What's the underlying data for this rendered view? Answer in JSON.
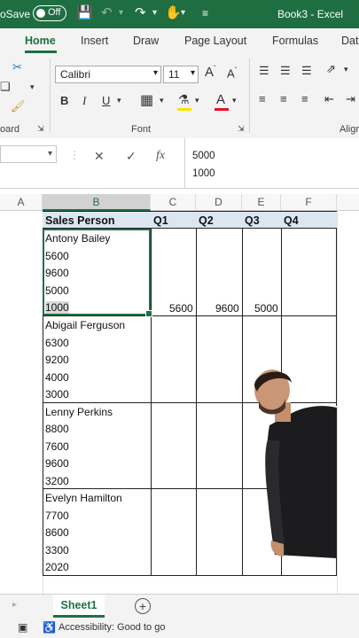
{
  "titlebar": {
    "autosave_label": "oSave",
    "toggle_state": "Off",
    "doc_title": "Book3 - Excel"
  },
  "ribbon_tabs": [
    "Home",
    "Insert",
    "Draw",
    "Page Layout",
    "Formulas",
    "Dat"
  ],
  "ribbon": {
    "font_name": "Calibri",
    "font_size": "11",
    "group_clipboard": "oard",
    "group_font": "Font",
    "group_alignment": "Aligr",
    "grow_font": "A",
    "shrink_font": "A",
    "bold": "B",
    "italic": "I",
    "underline": "U",
    "font_color_letter": "A"
  },
  "formula_bar": {
    "cancel": "✕",
    "enter": "✓",
    "fx": "fx",
    "line1": "5000",
    "line2": "1000"
  },
  "columns": [
    "A",
    "B",
    "C",
    "D",
    "E",
    "F"
  ],
  "header_row": {
    "sales_person": "Sales Person",
    "q1": "Q1",
    "q2": "Q2",
    "q3": "Q3",
    "q4": "Q4"
  },
  "records": [
    {
      "name": "Antony Bailey",
      "values": [
        "5600",
        "9600",
        "5000",
        "1000"
      ]
    },
    {
      "name": "Abigail Ferguson",
      "values": [
        "6300",
        "9200",
        "4000",
        "3000"
      ]
    },
    {
      "name": "Lenny Perkins",
      "values": [
        "8800",
        "7600",
        "9600",
        "3200"
      ]
    },
    {
      "name": "Evelyn Hamilton",
      "values": [
        "7700",
        "8600",
        "3300",
        "2020"
      ]
    }
  ],
  "row1_results": {
    "c": "5600",
    "d": "9600",
    "e": "5000"
  },
  "sheet_tab": "Sheet1",
  "add_sheet": "+",
  "status": "Accessibility: Good to go",
  "colors": {
    "excel_green": "#1e6e42",
    "header_fill": "#dce6f0"
  }
}
